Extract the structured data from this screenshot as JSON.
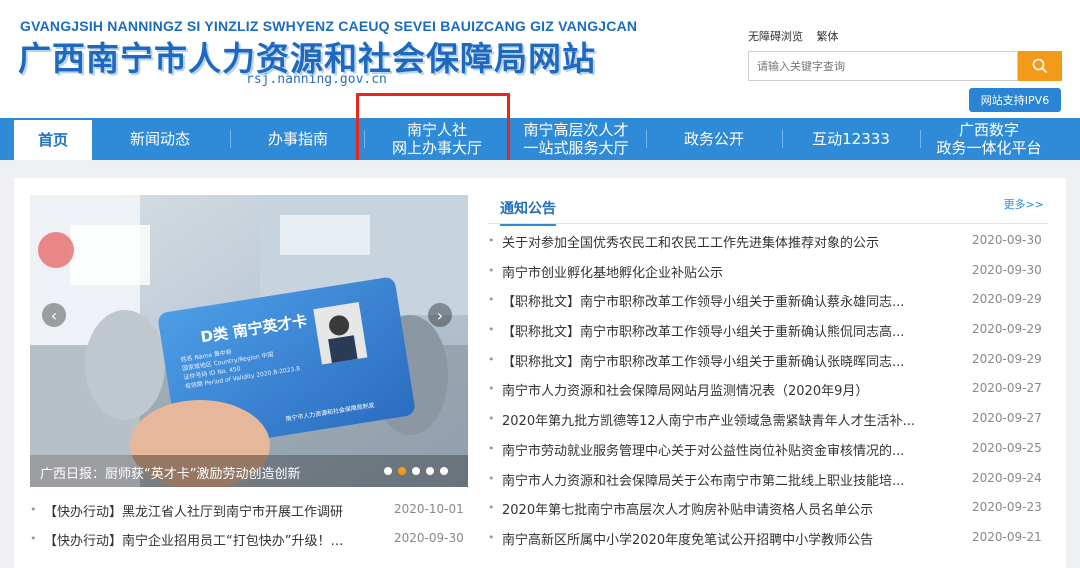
{
  "header": {
    "pinyin": "GVANGJSIH NANNINGZ SI YINZLIZ SWHYENZ CAEUQ SEVEI BAUIZCANG GIZ VANGJCAN",
    "title": "广西南宁市人力资源和社会保障局网站",
    "domain": "rsj.nanning.gov.cn",
    "links": {
      "accessible": "无障碍浏览",
      "traditional": "繁体"
    },
    "search": {
      "placeholder": "请输入关键字查询"
    },
    "ipv6": "网站支持IPV6"
  },
  "nav": {
    "items": [
      {
        "label": "首页",
        "active": true
      },
      {
        "label": "新闻动态"
      },
      {
        "label": "办事指南"
      },
      {
        "label": "南宁人社\n网上办事大厅"
      },
      {
        "label": "南宁高层次人才\n一站式服务大厅"
      },
      {
        "label": "政务公开"
      },
      {
        "label": "互动12333"
      },
      {
        "label": "广西数字\n政务一体化平台"
      }
    ]
  },
  "carousel": {
    "card": {
      "title": "D类 南宁英才卡",
      "name_label": "姓名 Name",
      "name_value": "黄中新",
      "nat_label": "国家或地区 Country/Region",
      "nat_value": "中国",
      "id_label": "证件号码 ID No.",
      "id_value": "450",
      "valid_label": "有效期 Period of Validity",
      "valid_value": "2020.8-2023.8",
      "issuer": "南宁市人力资源和社会保障局制发"
    },
    "caption": "广西日报：厨师获“英才卡”激励劳动创造创新",
    "dots": 5,
    "active_dot": 1
  },
  "left_news": [
    {
      "title": "【快办行动】黑龙江省人社厅到南宁市开展工作调研",
      "date": "2020-10-01"
    },
    {
      "title": "【快办行动】南宁企业招用员工“打包快办”升级！…",
      "date": "2020-09-30"
    }
  ],
  "notices": {
    "tab": "通知公告",
    "more": "更多>>",
    "items": [
      {
        "title": "关于对参加全国优秀农民工和农民工工作先进集体推荐对象的公示",
        "date": "2020-09-30"
      },
      {
        "title": "南宁市创业孵化基地孵化企业补贴公示",
        "date": "2020-09-30"
      },
      {
        "title": "【职称批文】南宁市职称改革工作领导小组关于重新确认蔡永雄同志...",
        "date": "2020-09-29"
      },
      {
        "title": "【职称批文】南宁市职称改革工作领导小组关于重新确认熊侃同志高...",
        "date": "2020-09-29"
      },
      {
        "title": "【职称批文】南宁市职称改革工作领导小组关于重新确认张晓晖同志...",
        "date": "2020-09-29"
      },
      {
        "title": "南宁市人力资源和社会保障局网站月监测情况表（2020年9月）",
        "date": "2020-09-27"
      },
      {
        "title": "2020年第九批方凯德等12人南宁市产业领域急需紧缺青年人才生活补...",
        "date": "2020-09-27"
      },
      {
        "title": "南宁市劳动就业服务管理中心关于对公益性岗位补贴资金审核情况的...",
        "date": "2020-09-25"
      },
      {
        "title": "南宁市人力资源和社会保障局关于公布南宁市第二批线上职业技能培...",
        "date": "2020-09-24"
      },
      {
        "title": "2020年第七批南宁市高层次人才购房补贴申请资格人员名单公示",
        "date": "2020-09-23"
      },
      {
        "title": "南宁高新区所属中小学2020年度免笔试公开招聘中小学教师公告",
        "date": "2020-09-21"
      }
    ]
  },
  "colors": {
    "brand_blue": "#2f8bd8",
    "accent_orange": "#f39a1a",
    "highlight_red": "#e8261c"
  }
}
